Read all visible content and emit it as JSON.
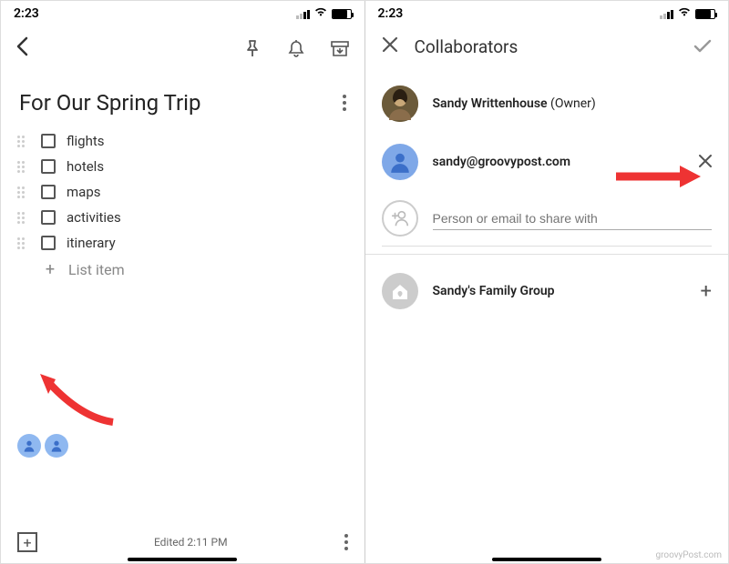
{
  "status": {
    "time": "2:23"
  },
  "left": {
    "title": "For Our Spring Trip",
    "items": [
      "flights",
      "hotels",
      "maps",
      "activities",
      "itinerary"
    ],
    "add_placeholder": "List item",
    "edited": "Edited 2:11 PM"
  },
  "right": {
    "header": "Collaborators",
    "owner": {
      "name": "Sandy Writtenhouse",
      "tag": "(Owner)"
    },
    "shared": {
      "email": "sandy@groovypost.com"
    },
    "input_placeholder": "Person or email to share with",
    "group": {
      "name": "Sandy's Family Group"
    }
  },
  "watermark": "groovyPost.com"
}
